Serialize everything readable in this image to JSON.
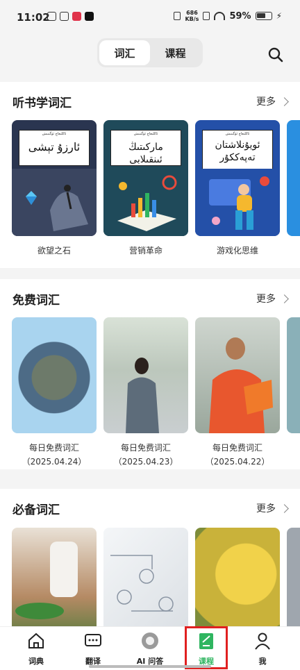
{
  "status": {
    "time": "11:02",
    "net_speed_top": "686",
    "net_speed_bottom": "KB/s",
    "battery": "59%"
  },
  "header": {
    "tabs": [
      {
        "label": "词汇",
        "active": true
      },
      {
        "label": "课程",
        "active": false
      }
    ],
    "search_icon": "search-icon"
  },
  "sections": [
    {
      "title": "听书学词汇",
      "more": "更多",
      "items": [
        {
          "cover_title": "ئارزۇ تېشى",
          "caption": "欲望之石"
        },
        {
          "cover_title": "ماركىتىڭ ئىنقىلابى",
          "caption": "营销革命"
        },
        {
          "cover_title": "ئويۇنلاشتان تەپەككۇر",
          "caption": "游戏化思维"
        }
      ]
    },
    {
      "title": "免费词汇",
      "more": "更多",
      "items": [
        {
          "caption": "每日免费词汇",
          "date": "（2025.04.24）"
        },
        {
          "caption": "每日免费词汇",
          "date": "（2025.04.23）"
        },
        {
          "caption": "每日免费词汇",
          "date": "（2025.04.22）"
        }
      ]
    },
    {
      "title": "必备词汇",
      "more": "更多"
    }
  ],
  "nav": [
    {
      "label": "词典",
      "icon": "house-icon"
    },
    {
      "label": "翻译",
      "icon": "chat-bubble-icon"
    },
    {
      "label": "AI 问答",
      "icon": "ai-orb-icon"
    },
    {
      "label": "课程",
      "icon": "notebook-pen-icon",
      "active": true
    },
    {
      "label": "我",
      "icon": "person-icon"
    }
  ],
  "colors": {
    "accent": "#2fb560",
    "highlight": "#e02020",
    "book_bg": "#1e2a46"
  }
}
